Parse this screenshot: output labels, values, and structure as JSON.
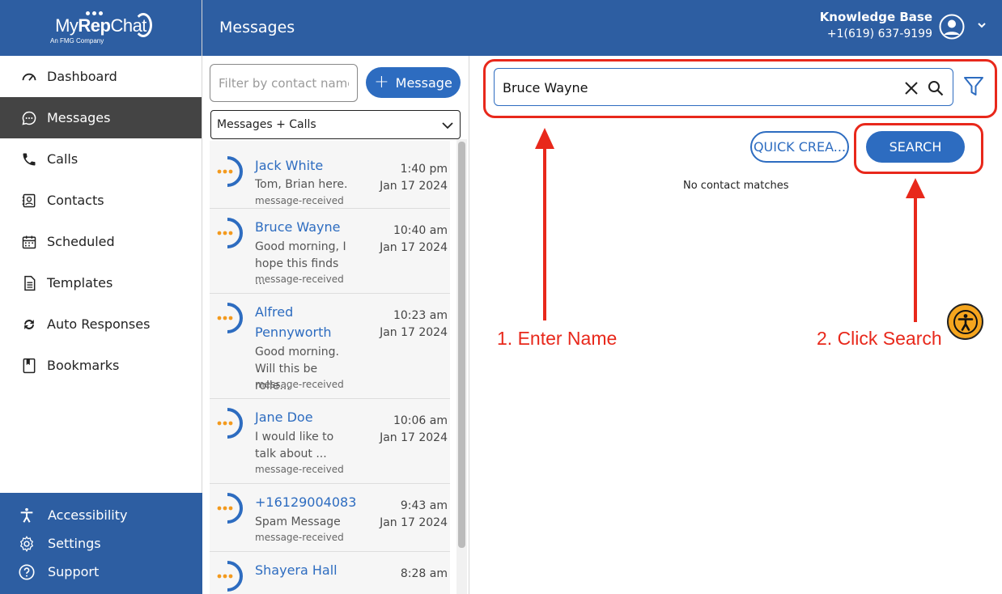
{
  "app": {
    "logo_text_light": "My",
    "logo_text_bold": "Rep",
    "logo_text_end": "Chat",
    "logo_sub": "An FMG Company"
  },
  "sidebar": {
    "items": [
      {
        "label": "Dashboard",
        "icon": "gauge-icon"
      },
      {
        "label": "Messages",
        "icon": "chat-bubble-icon",
        "active": true
      },
      {
        "label": "Calls",
        "icon": "phone-icon"
      },
      {
        "label": "Contacts",
        "icon": "contact-card-icon"
      },
      {
        "label": "Scheduled",
        "icon": "calendar-icon"
      },
      {
        "label": "Templates",
        "icon": "document-icon"
      },
      {
        "label": "Auto Responses",
        "icon": "sync-icon"
      },
      {
        "label": "Bookmarks",
        "icon": "bookmark-icon"
      }
    ],
    "bottom": [
      {
        "label": "Accessibility",
        "icon": "accessibility-icon"
      },
      {
        "label": "Settings",
        "icon": "gear-icon"
      },
      {
        "label": "Support",
        "icon": "help-icon"
      }
    ]
  },
  "header": {
    "title": "Messages",
    "account_name": "Knowledge Base",
    "account_phone": "+1(619) 637-9199"
  },
  "conversations_panel": {
    "filter_placeholder": "Filter by contact name",
    "new_message_label": "Message",
    "type_filter": "Messages + Calls",
    "conversations": [
      {
        "name": "Jack White",
        "snippet": "Tom, Brian here.",
        "status": "message-received",
        "time": "1:40 pm",
        "date": "Jan 17 2024"
      },
      {
        "name": "Bruce Wayne",
        "snippet": "Good morning, I hope this finds ...",
        "status": "message-received",
        "time": "10:40 am",
        "date": "Jan 17 2024"
      },
      {
        "name": "Alfred Pennyworth",
        "snippet": "Good morning. Will this be rolle...",
        "status": "message-received",
        "time": "10:23 am",
        "date": "Jan 17 2024"
      },
      {
        "name": "Jane Doe",
        "snippet": "I would like to talk about ...",
        "status": "message-received",
        "time": "10:06 am",
        "date": "Jan 17 2024"
      },
      {
        "name": "+16129004083",
        "snippet": "Spam Message",
        "status": "message-received",
        "time": "9:43 am",
        "date": "Jan 17 2024"
      },
      {
        "name": "Shayera Hall",
        "snippet": "",
        "status": "",
        "time": "8:28 am",
        "date": ""
      }
    ]
  },
  "contact_search": {
    "query": "Bruce Wayne",
    "quick_create_label": "QUICK CREA...",
    "search_label": "SEARCH",
    "no_results": "No contact matches"
  },
  "annotations": {
    "step1": "1. Enter Name",
    "step2": "2. Click Search"
  },
  "colors": {
    "brand_blue": "#2d5ea2",
    "accent_blue": "#2d6cc0",
    "annotation_red": "#e8281b",
    "accessibility_orange": "#f5a51e"
  }
}
